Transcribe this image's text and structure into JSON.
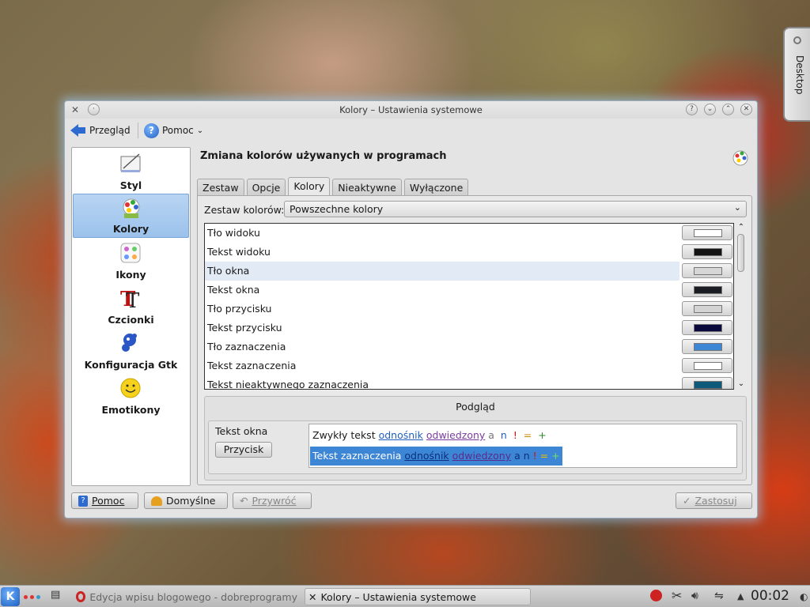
{
  "window": {
    "title": "Kolory – Ustawienia systemowe",
    "buttons": {
      "help": "?",
      "minimize": "⌄",
      "maximize": "⌃",
      "close": "✕"
    }
  },
  "toolbar": {
    "back_label": "Przegląd",
    "help_label": "Pomoc"
  },
  "sidebar": {
    "items": [
      {
        "label": "Styl",
        "icon": "style-icon"
      },
      {
        "label": "Kolory",
        "icon": "colors-icon",
        "active": true
      },
      {
        "label": "Ikony",
        "icon": "icons-icon"
      },
      {
        "label": "Czcionki",
        "icon": "fonts-icon"
      },
      {
        "label": "Konfiguracja Gtk",
        "icon": "gtk-icon"
      },
      {
        "label": "Emotikony",
        "icon": "emoticons-icon"
      }
    ]
  },
  "main": {
    "heading": "Zmiana kolorów używanych w programach",
    "tabs": [
      "Zestaw",
      "Opcje",
      "Kolory",
      "Nieaktywne",
      "Wyłączone"
    ],
    "active_tab": "Kolory",
    "scheme_label": "Zestaw kolorów:",
    "scheme_value": "Powszechne kolory",
    "color_rows": [
      {
        "label": "Tło widoku",
        "color": "#ffffff"
      },
      {
        "label": "Tekst widoku",
        "color": "#141414"
      },
      {
        "label": "Tło okna",
        "color": "#d6d6d6",
        "highlighted": true
      },
      {
        "label": "Tekst okna",
        "color": "#1c1c24"
      },
      {
        "label": "Tło przycisku",
        "color": "#d4d4d4"
      },
      {
        "label": "Tekst przycisku",
        "color": "#0a0a3c"
      },
      {
        "label": "Tło zaznaczenia",
        "color": "#3d86d6"
      },
      {
        "label": "Tekst zaznaczenia",
        "color": "#ffffff"
      },
      {
        "label": "Tekst nieaktywnego zaznaczenia",
        "color": "#0e5a7a"
      }
    ]
  },
  "preview": {
    "title": "Podgląd",
    "window_text": "Tekst okna",
    "button_label": "Przycisk",
    "line1": {
      "text": "Zwykły tekst",
      "link": "odnośnik",
      "visited": "odwiedzony",
      "a": "a",
      "n": "n",
      "excl": "!",
      "eq": "=",
      "plus": "+"
    },
    "line2": {
      "text": "Tekst zaznaczenia",
      "link": "odnośnik",
      "visited": "odwiedzony",
      "a": "a",
      "n": "n",
      "excl": "!",
      "eq": "=",
      "plus": "+"
    }
  },
  "buttons": {
    "help": "Pomoc",
    "defaults": "Domyślne",
    "reset": "Przywróć",
    "apply": "Zastosuj"
  },
  "desktop_toolbox": {
    "label": "Desktop"
  },
  "taskbar": {
    "start_label": "K",
    "tasks": [
      {
        "label": "Edycja wpisu blogowego - dobreprogramy",
        "active": false
      },
      {
        "label": "Kolory – Ustawienia systemowe",
        "active": true
      }
    ],
    "clock": "00:02"
  },
  "colors": {
    "accent": "#3d86d6",
    "selection_bg": "#b8d4f2"
  }
}
